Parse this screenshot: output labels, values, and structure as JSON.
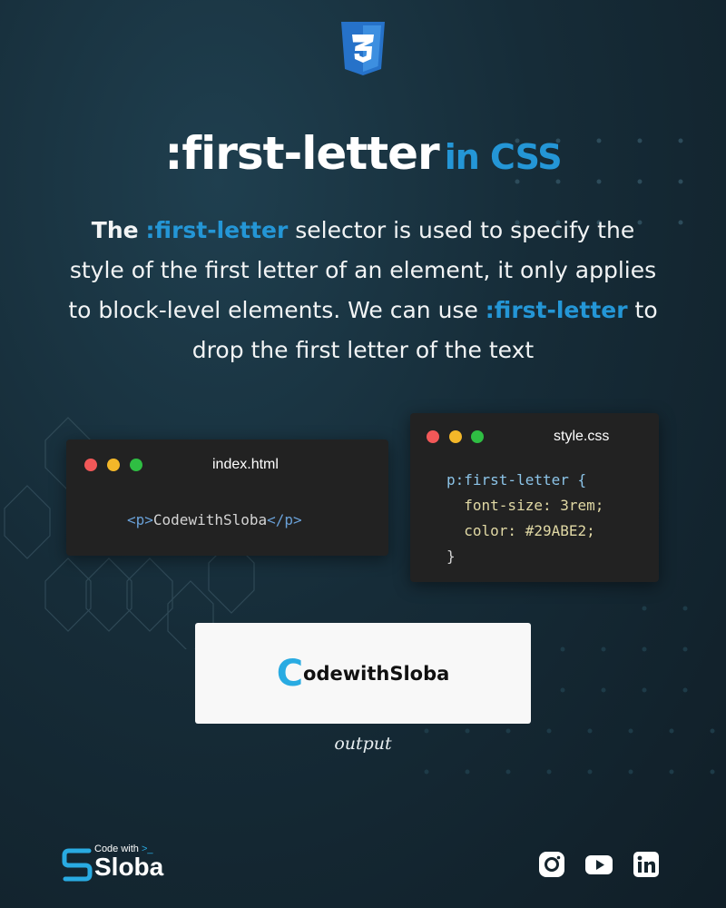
{
  "title": {
    "main": ":first-letter",
    "accent": "in CSS"
  },
  "description": {
    "part1": "The",
    "highlight1": ":first-letter",
    "part2": "selector is used to specify the style of the first letter of an element, it only applies to block-level elements. We can use",
    "highlight2": ":first-letter",
    "part3": "to drop the first letter of the text"
  },
  "html_window": {
    "filename": "index.html",
    "code": {
      "open_tag": "<p>",
      "content": "CodewithSloba",
      "close_tag": "</p>"
    }
  },
  "css_window": {
    "filename": "style.css",
    "code": {
      "line1": "p:first-letter {",
      "line2": "  font-size: 3rem;",
      "line3": "  color: #29ABE2;",
      "line4": "}"
    }
  },
  "output": {
    "first_letter": "C",
    "rest": "odewithSloba",
    "label": "output",
    "first_letter_color": "#29ABE2"
  },
  "brand": {
    "small": "Code with",
    "prompt": ">_",
    "big": "Sloba"
  },
  "icons": [
    "css3-logo-icon",
    "instagram-icon",
    "youtube-icon",
    "linkedin-icon"
  ],
  "colors": {
    "accent": "#2496d6",
    "background": "#162c38",
    "window": "#222222"
  }
}
